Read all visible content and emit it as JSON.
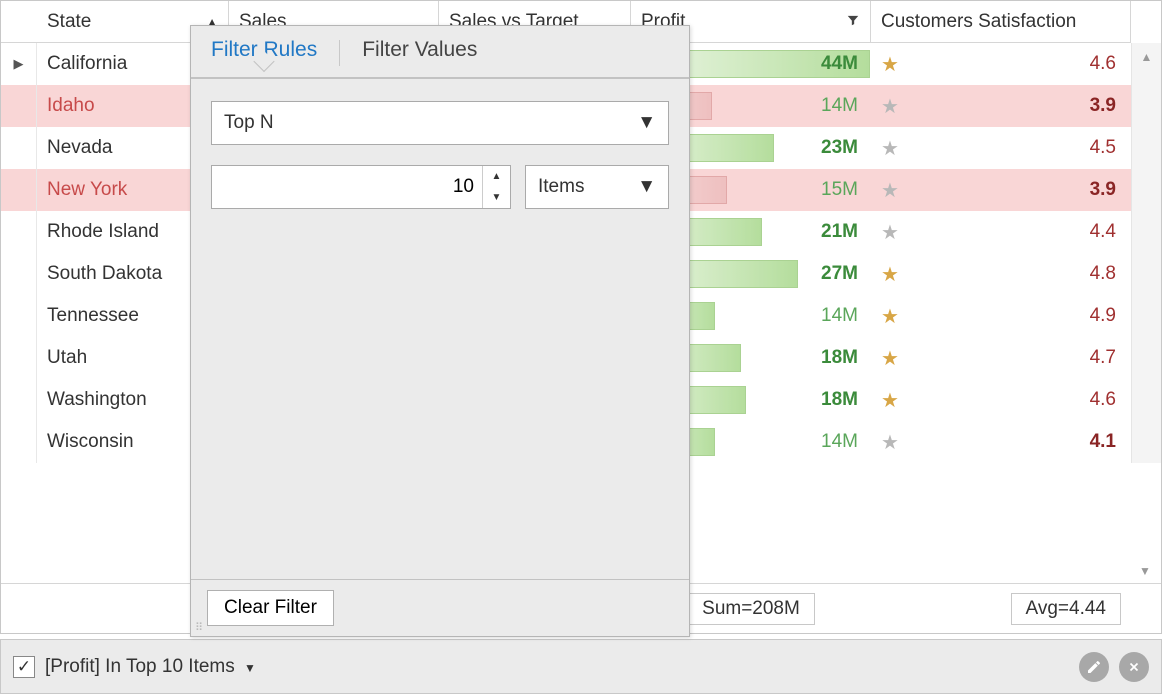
{
  "columns": {
    "state": "State",
    "sales": "Sales",
    "sales_vs_target": "Sales vs Target",
    "profit": "Profit",
    "csat": "Customers Satisfaction"
  },
  "rows": [
    {
      "state": "California",
      "profit": "44M",
      "profit_pct": 100,
      "bold": true,
      "csat": "4.6",
      "star": "gold",
      "pink": false,
      "csat_bold": false
    },
    {
      "state": "Idaho",
      "profit": "14M",
      "profit_pct": 34,
      "bold": false,
      "csat": "3.9",
      "star": "gray",
      "pink": true,
      "csat_bold": true
    },
    {
      "state": "Nevada",
      "profit": "23M",
      "profit_pct": 60,
      "bold": true,
      "csat": "4.5",
      "star": "gray",
      "pink": false,
      "csat_bold": false
    },
    {
      "state": "New York",
      "profit": "15M",
      "profit_pct": 40,
      "bold": false,
      "csat": "3.9",
      "star": "gray",
      "pink": true,
      "csat_bold": true
    },
    {
      "state": "Rhode Island",
      "profit": "21M",
      "profit_pct": 55,
      "bold": true,
      "csat": "4.4",
      "star": "gray",
      "pink": false,
      "csat_bold": false
    },
    {
      "state": "South Dakota",
      "profit": "27M",
      "profit_pct": 70,
      "bold": true,
      "csat": "4.8",
      "star": "gold",
      "pink": false,
      "csat_bold": false
    },
    {
      "state": "Tennessee",
      "profit": "14M",
      "profit_pct": 35,
      "bold": false,
      "csat": "4.9",
      "star": "gold",
      "pink": false,
      "csat_bold": false
    },
    {
      "state": "Utah",
      "profit": "18M",
      "profit_pct": 46,
      "bold": true,
      "csat": "4.7",
      "star": "gold",
      "pink": false,
      "csat_bold": false
    },
    {
      "state": "Washington",
      "profit": "18M",
      "profit_pct": 48,
      "bold": true,
      "csat": "4.6",
      "star": "gold",
      "pink": false,
      "csat_bold": false
    },
    {
      "state": "Wisconsin",
      "profit": "14M",
      "profit_pct": 35,
      "bold": false,
      "csat": "4.1",
      "star": "gray",
      "pink": false,
      "csat_bold": true
    }
  ],
  "footer": {
    "sum_label": "Sum=208M",
    "avg_label": "Avg=4.44"
  },
  "filter_bar": {
    "checked": true,
    "expression": "[Profit] In Top 10 Items"
  },
  "popup": {
    "tabs": {
      "rules": "Filter Rules",
      "values": "Filter Values"
    },
    "rule_type": "Top N",
    "n_value": "10",
    "unit": "Items",
    "clear_label": "Clear Filter"
  }
}
